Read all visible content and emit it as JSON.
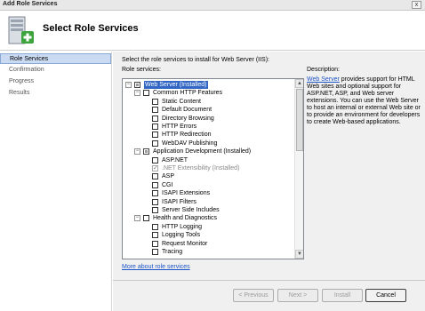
{
  "window": {
    "title": "Add Role Services",
    "close_glyph": "x"
  },
  "header": {
    "heading": "Select Role Services"
  },
  "nav": {
    "items": [
      {
        "label": "Role Services",
        "active": true
      },
      {
        "label": "Confirmation",
        "active": false
      },
      {
        "label": "Progress",
        "active": false
      },
      {
        "label": "Results",
        "active": false
      }
    ]
  },
  "content": {
    "intro": "Select the role services to install for Web Server (IIS):",
    "role_services_label": "Role services:",
    "description_label": "Description:",
    "description_link": "Web Server",
    "description_text": " provides support for HTML Web sites and optional support for ASP.NET, ASP, and Web server extensions. You can use the Web Server to host an internal or external Web site or to provide an environment for developers to create Web-based applications.",
    "more_link": "More about role services"
  },
  "tree": {
    "rows": [
      {
        "label": "Web Server  (Installed)",
        "level": 0,
        "expander": "−",
        "checkbox": "indeterminate",
        "selected": true
      },
      {
        "label": "Common HTTP Features",
        "level": 1,
        "expander": "−",
        "checkbox": "unchecked"
      },
      {
        "label": "Static Content",
        "level": 2,
        "checkbox": "unchecked"
      },
      {
        "label": "Default Document",
        "level": 2,
        "checkbox": "unchecked"
      },
      {
        "label": "Directory Browsing",
        "level": 2,
        "checkbox": "unchecked"
      },
      {
        "label": "HTTP Errors",
        "level": 2,
        "checkbox": "unchecked"
      },
      {
        "label": "HTTP Redirection",
        "level": 2,
        "checkbox": "unchecked"
      },
      {
        "label": "WebDAV Publishing",
        "level": 2,
        "checkbox": "unchecked"
      },
      {
        "label": "Application Development  (Installed)",
        "level": 1,
        "expander": "−",
        "checkbox": "indeterminate"
      },
      {
        "label": "ASP.NET",
        "level": 2,
        "checkbox": "unchecked"
      },
      {
        "label": ".NET Extensibility  (Installed)",
        "level": 2,
        "checkbox": "checked-disabled",
        "disabled": true
      },
      {
        "label": "ASP",
        "level": 2,
        "checkbox": "unchecked"
      },
      {
        "label": "CGI",
        "level": 2,
        "checkbox": "unchecked"
      },
      {
        "label": "ISAPI Extensions",
        "level": 2,
        "checkbox": "unchecked"
      },
      {
        "label": "ISAPI Filters",
        "level": 2,
        "checkbox": "unchecked"
      },
      {
        "label": "Server Side Includes",
        "level": 2,
        "checkbox": "unchecked"
      },
      {
        "label": "Health and Diagnostics",
        "level": 1,
        "expander": "−",
        "checkbox": "unchecked"
      },
      {
        "label": "HTTP Logging",
        "level": 2,
        "checkbox": "unchecked"
      },
      {
        "label": "Logging Tools",
        "level": 2,
        "checkbox": "unchecked"
      },
      {
        "label": "Request Monitor",
        "level": 2,
        "checkbox": "unchecked"
      },
      {
        "label": "Tracing",
        "level": 2,
        "checkbox": "unchecked"
      }
    ]
  },
  "buttons": {
    "previous": "< Previous",
    "next": "Next >",
    "install": "Install",
    "cancel": "Cancel"
  }
}
